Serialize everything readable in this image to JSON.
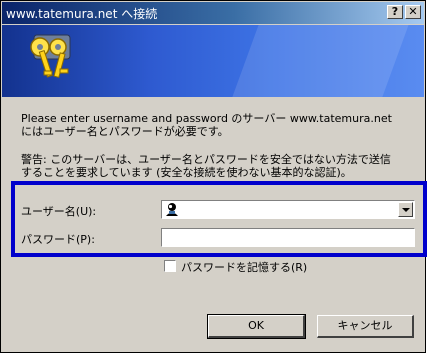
{
  "window": {
    "title": "www.tatemura.net へ接続",
    "help_button": "?",
    "close_button": "✕"
  },
  "message": {
    "line1": "Please enter username and password のサーバー www.tatemura.net",
    "line2": "にはユーザー名とパスワードが必要です。",
    "warning1": "警告: このサーバーは、ユーザー名とパスワードを安全ではない方法で送信",
    "warning2": "することを要求しています (安全な接続を使わない基本的な認証)。"
  },
  "form": {
    "username_label": "ユーザー名(U):",
    "username_value": "",
    "password_label": "パスワード(P):",
    "password_value": "",
    "remember_label": "パスワードを記憶する(R)",
    "remember_checked": false
  },
  "buttons": {
    "ok": "OK",
    "cancel": "キャンセル"
  },
  "colors": {
    "highlight_box": "#0000cc",
    "titlebar_start": "#0a246a",
    "titlebar_end": "#a6caf0"
  }
}
